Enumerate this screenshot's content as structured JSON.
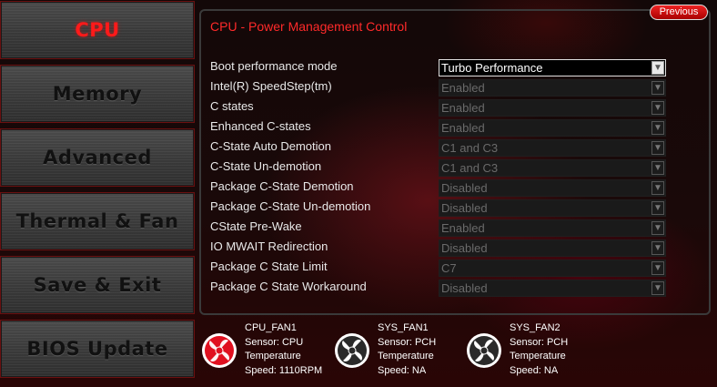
{
  "sidebar": {
    "items": [
      {
        "label": "CPU",
        "active": true
      },
      {
        "label": "Memory",
        "active": false
      },
      {
        "label": "Advanced",
        "active": false
      },
      {
        "label": "Thermal & Fan",
        "active": false
      },
      {
        "label": "Save & Exit",
        "active": false
      },
      {
        "label": "BIOS Update",
        "active": false
      }
    ]
  },
  "header": {
    "title": "CPU - Power Management Control",
    "previous_label": "Previous"
  },
  "settings": [
    {
      "label": "Boot performance mode",
      "value": "Turbo Performance",
      "enabled": true
    },
    {
      "label": "Intel(R) SpeedStep(tm)",
      "value": "Enabled",
      "enabled": false
    },
    {
      "label": "C states",
      "value": "Enabled",
      "enabled": false
    },
    {
      "label": "Enhanced C-states",
      "value": "Enabled",
      "enabled": false
    },
    {
      "label": "C-State Auto Demotion",
      "value": "C1 and C3",
      "enabled": false
    },
    {
      "label": "C-State Un-demotion",
      "value": "C1 and C3",
      "enabled": false
    },
    {
      "label": "Package C-State Demotion",
      "value": "Disabled",
      "enabled": false
    },
    {
      "label": "Package C-State Un-demotion",
      "value": "Disabled",
      "enabled": false
    },
    {
      "label": "CState Pre-Wake",
      "value": "Enabled",
      "enabled": false
    },
    {
      "label": "IO MWAIT Redirection",
      "value": "Disabled",
      "enabled": false
    },
    {
      "label": "Package C State Limit",
      "value": "C7",
      "enabled": false
    },
    {
      "label": "Package C State Workaround",
      "value": "Disabled",
      "enabled": false
    }
  ],
  "fans": [
    {
      "name": "CPU_FAN1",
      "sensor": "Sensor: CPU",
      "temp": "Temperature",
      "speed": "Speed:  1110RPM",
      "active": true
    },
    {
      "name": "SYS_FAN1",
      "sensor": "Sensor: PCH",
      "temp": "Temperature",
      "speed": "Speed:  NA",
      "active": false
    },
    {
      "name": "SYS_FAN2",
      "sensor": "Sensor: PCH",
      "temp": "Temperature",
      "speed": "Speed:  NA",
      "active": false
    }
  ],
  "icons": {
    "dropdown": "chevron-down-icon",
    "fan": "fan-icon"
  },
  "colors": {
    "accent": "#ff2a2a",
    "active_fan": "#e01020",
    "inactive_fan": "#e8e8e8"
  }
}
